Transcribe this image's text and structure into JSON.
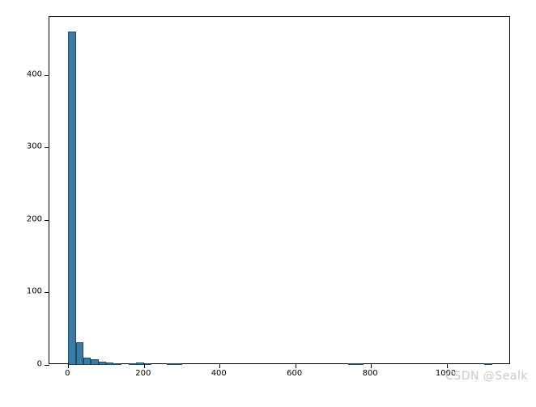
{
  "chart_data": {
    "type": "bar",
    "bin_width": 20,
    "x": [
      10,
      30,
      50,
      70,
      90,
      110,
      130,
      150,
      170,
      190,
      210,
      230,
      250,
      270,
      290,
      750,
      770,
      1090,
      1110
    ],
    "values": [
      460,
      31,
      10,
      8,
      5,
      3,
      2,
      0,
      2,
      3,
      2,
      0,
      0,
      2,
      1,
      1,
      1,
      0,
      1
    ],
    "x_ticks": [
      0,
      200,
      400,
      600,
      800,
      1000
    ],
    "y_ticks": [
      0,
      100,
      200,
      300,
      400
    ],
    "xlim": [
      -50,
      1170
    ],
    "ylim": [
      0,
      480
    ],
    "title": "",
    "xlabel": "",
    "ylabel": "",
    "bar_color": "#3a7ba5",
    "bar_edge": "#1f4a63"
  },
  "watermark": "CSDN @Sealk"
}
